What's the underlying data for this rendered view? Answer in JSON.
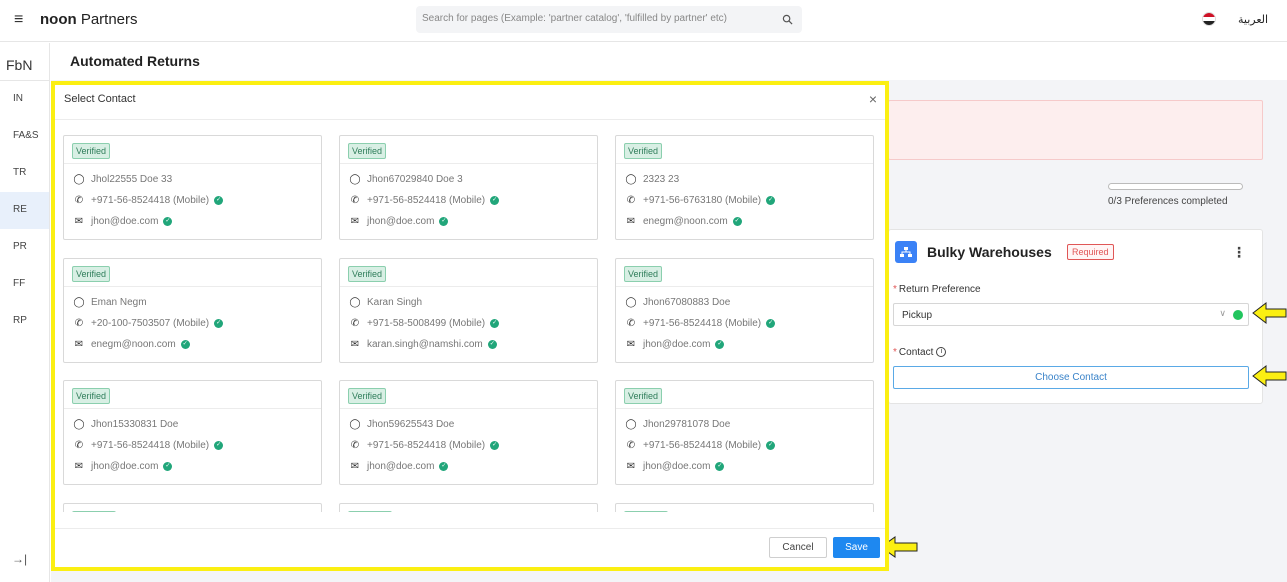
{
  "header": {
    "menu_glyph": "≡",
    "brand_bold": "noon",
    "brand_rest": " Partners",
    "search_placeholder": "Search for pages (Example: 'partner catalog', 'fulfilled by partner' etc)",
    "language": "العربية"
  },
  "sidebar": {
    "title": "FbN",
    "items": [
      {
        "label": "IN"
      },
      {
        "label": "FA&S"
      },
      {
        "label": "TR"
      },
      {
        "label": "RE"
      },
      {
        "label": "PR"
      },
      {
        "label": "FF"
      },
      {
        "label": "RP"
      }
    ],
    "active_index": 3,
    "collapse_glyph": "→|"
  },
  "page": {
    "title": "Automated Returns"
  },
  "preferences": {
    "progress_text": "0/3 Preferences completed",
    "progress_fraction": 0
  },
  "warehouse_card": {
    "title": "Bulky Warehouses",
    "badge": "Required",
    "return_pref_label": "Return Preference",
    "return_pref_value": "Pickup",
    "contact_label": "Contact",
    "choose_contact": "Choose Contact"
  },
  "modal": {
    "title": "Select Contact",
    "close_glyph": "×",
    "cancel_label": "Cancel",
    "save_label": "Save",
    "contacts": [
      {
        "badge": "Verified",
        "name": "Jhol22555 Doe 33",
        "phone": "+971-56-8524418 (Mobile)",
        "email": "jhon@doe.com"
      },
      {
        "badge": "Verified",
        "name": "Jhon67029840 Doe 3",
        "phone": "+971-56-8524418 (Mobile)",
        "email": "jhon@doe.com"
      },
      {
        "badge": "Verified",
        "name": "2323 23",
        "phone": "+971-56-6763180 (Mobile)",
        "email": "enegm@noon.com"
      },
      {
        "badge": "Verified",
        "name": "Eman Negm",
        "phone": "+20-100-7503507 (Mobile)",
        "email": "enegm@noon.com"
      },
      {
        "badge": "Verified",
        "name": "Karan Singh",
        "phone": "+971-58-5008499 (Mobile)",
        "email": "karan.singh@namshi.com"
      },
      {
        "badge": "Verified",
        "name": "Jhon67080883 Doe",
        "phone": "+971-56-8524418 (Mobile)",
        "email": "jhon@doe.com"
      },
      {
        "badge": "Verified",
        "name": "Jhon15330831 Doe",
        "phone": "+971-56-8524418 (Mobile)",
        "email": "jhon@doe.com"
      },
      {
        "badge": "Verified",
        "name": "Jhon59625543 Doe",
        "phone": "+971-56-8524418 (Mobile)",
        "email": "jhon@doe.com"
      },
      {
        "badge": "Verified",
        "name": "Jhon29781078 Doe",
        "phone": "+971-56-8524418 (Mobile)",
        "email": "jhon@doe.com"
      }
    ]
  },
  "colors": {
    "highlight": "#fbef12",
    "primary": "#1e88f0",
    "verified_green": "#21a67a"
  },
  "icons": [
    "menu-icon",
    "search-icon",
    "egypt-flag-icon",
    "collapse-sidebar-icon",
    "user-icon",
    "phone-icon",
    "mail-icon",
    "verified-check-icon",
    "close-icon",
    "warehouse-icon",
    "kebab-menu-icon",
    "chevron-down-icon",
    "info-icon",
    "pointer-arrow-icon"
  ]
}
